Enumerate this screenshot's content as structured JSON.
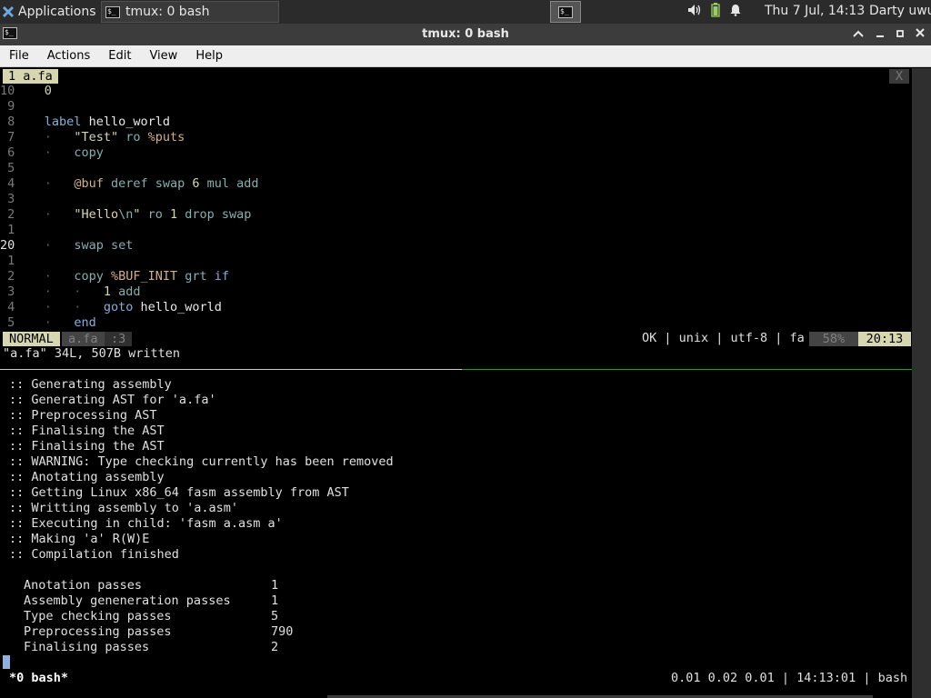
{
  "panel": {
    "apps_label": "Applications",
    "task_label": "tmux: 0 bash",
    "workspace_glyph": "$_",
    "clock": "Thu  7 Jul, 14:13",
    "user": "Darty uwu"
  },
  "window": {
    "title": "tmux: 0 bash",
    "icon_glyph": "$_"
  },
  "menu": [
    "File",
    "Actions",
    "Edit",
    "View",
    "Help"
  ],
  "editor": {
    "tab_label": "1 a.fa",
    "tab_close": "X",
    "lines": [
      {
        "ln": "10",
        "indent": "  ",
        "code": [
          {
            "c": "num",
            "t": "0"
          }
        ]
      },
      {
        "ln": " 9",
        "indent": "",
        "code": []
      },
      {
        "ln": " 8",
        "indent": "  ",
        "code": [
          {
            "c": "kw",
            "t": "label"
          },
          {
            "c": "id",
            "t": " hello_world"
          }
        ]
      },
      {
        "ln": " 7",
        "indent": "  ·   ",
        "code": [
          {
            "c": "str",
            "t": "\"Test\""
          },
          {
            "c": "op",
            "t": " ro"
          },
          {
            "c": "mac",
            "t": " %puts"
          }
        ]
      },
      {
        "ln": " 6",
        "indent": "  ·   ",
        "code": [
          {
            "c": "op",
            "t": "copy"
          }
        ]
      },
      {
        "ln": " 5",
        "indent": "",
        "code": []
      },
      {
        "ln": " 4",
        "indent": "  ·   ",
        "code": [
          {
            "c": "mac",
            "t": "@buf"
          },
          {
            "c": "op",
            "t": " deref swap"
          },
          {
            "c": "num",
            "t": " 6"
          },
          {
            "c": "op",
            "t": " mul add"
          }
        ]
      },
      {
        "ln": " 3",
        "indent": "",
        "code": []
      },
      {
        "ln": " 2",
        "indent": "  ·   ",
        "code": [
          {
            "c": "str",
            "t": "\"Hello"
          },
          {
            "c": "esc",
            "t": "\\n"
          },
          {
            "c": "str",
            "t": "\""
          },
          {
            "c": "op",
            "t": " ro"
          },
          {
            "c": "num",
            "t": " 1"
          },
          {
            "c": "op",
            "t": " drop swap"
          }
        ]
      },
      {
        "ln": " 1",
        "indent": "",
        "code": []
      },
      {
        "ln": "20",
        "indent": "  ·   ",
        "code": [
          {
            "c": "op",
            "t": "swap set"
          }
        ],
        "current": true
      },
      {
        "ln": " 1",
        "indent": "",
        "code": []
      },
      {
        "ln": " 2",
        "indent": "  ·   ",
        "code": [
          {
            "c": "op",
            "t": "copy"
          },
          {
            "c": "mac",
            "t": " %BUF_INIT"
          },
          {
            "c": "op",
            "t": " grt"
          },
          {
            "c": "kw",
            "t": " if"
          }
        ]
      },
      {
        "ln": " 3",
        "indent": "  ·   ·   ",
        "code": [
          {
            "c": "num",
            "t": "1"
          },
          {
            "c": "op",
            "t": " add"
          }
        ]
      },
      {
        "ln": " 4",
        "indent": "  ·   ·   ",
        "code": [
          {
            "c": "kw",
            "t": "goto"
          },
          {
            "c": "id",
            "t": " hello_world"
          }
        ]
      },
      {
        "ln": " 5",
        "indent": "  ·   ",
        "code": [
          {
            "c": "kw",
            "t": "end"
          }
        ]
      }
    ],
    "status": {
      "mode": "NORMAL",
      "file": "a.fa",
      "position": ":3",
      "info": "OK | unix | utf-8 | fa",
      "percent": "58%",
      "line_col": "20:13"
    },
    "message": "\"a.fa\" 34L, 507B written"
  },
  "shell": {
    "output": [
      ":: Generating assembly",
      ":: Generating AST for 'a.fa'",
      ":: Preprocessing AST",
      ":: Finalising the AST",
      ":: Finalising the AST",
      ":: WARNING: Type checking currently has been removed",
      ":: Anotating assembly",
      ":: Getting Linux x86_64 fasm assembly from AST",
      ":: Writting assembly to 'a.asm'",
      ":: Executing in child: 'fasm a.asm a'",
      ":: Making 'a' R(W)E",
      ":: Compilation finished"
    ],
    "stats": [
      {
        "label": "Anotation passes",
        "value": "1"
      },
      {
        "label": "Assembly geneneration passes",
        "value": "1"
      },
      {
        "label": "Type checking passes",
        "value": "5"
      },
      {
        "label": "Preprocessing passes",
        "value": "790"
      },
      {
        "label": "Finalising passes",
        "value": "2"
      }
    ]
  },
  "tmux": {
    "window_label": "*0 bash*",
    "right_status": "0.01 0.02 0.01 | 14:13:01 | bash"
  }
}
